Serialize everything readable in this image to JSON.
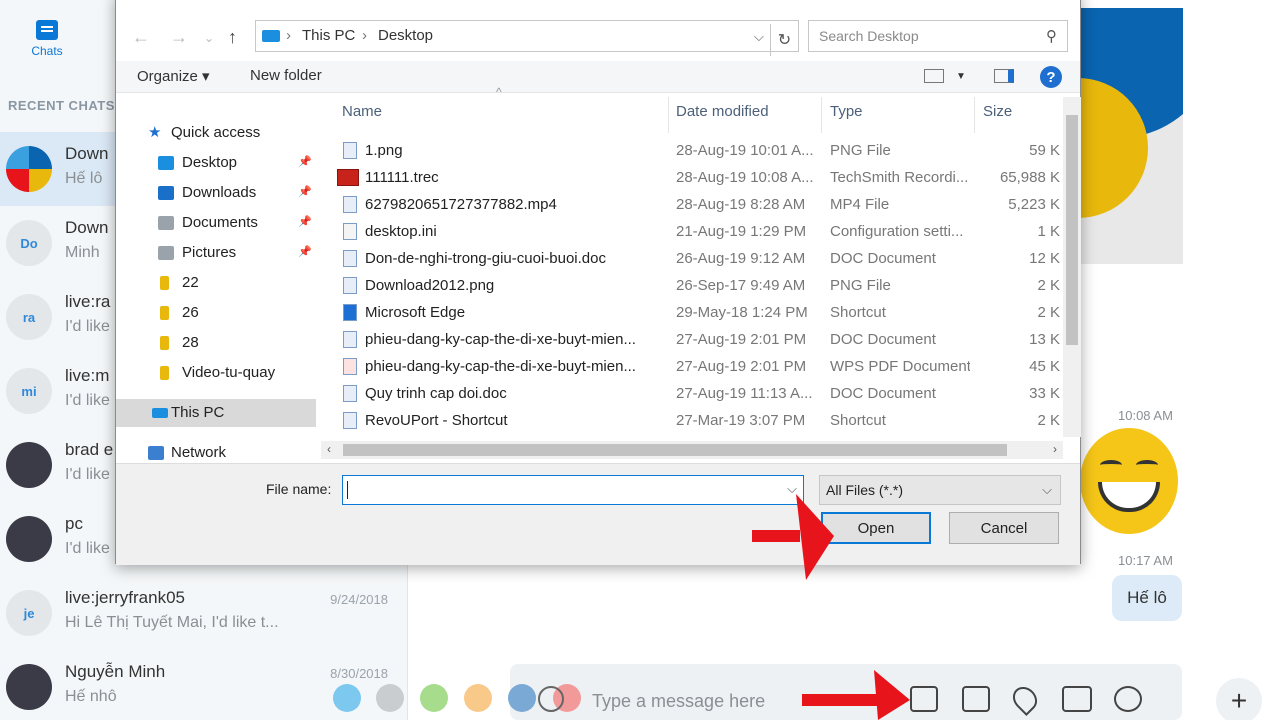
{
  "skype": {
    "nav_chats_label": "Chats",
    "recent_label": "RECENT CHATS",
    "chats": [
      {
        "name": "Down",
        "preview": "Hế lô",
        "date": "",
        "avatar": ""
      },
      {
        "name": "Down",
        "preview": "Minh",
        "date": "",
        "avatar": "Do"
      },
      {
        "name": "live:ra",
        "preview": "I'd like",
        "date": "",
        "avatar": "ra"
      },
      {
        "name": "live:m",
        "preview": "I'd like",
        "date": "",
        "avatar": "mi"
      },
      {
        "name": "brad e",
        "preview": "I'd like",
        "date": "",
        "avatar": ""
      },
      {
        "name": "pc",
        "preview": "I'd like",
        "date": "",
        "avatar": ""
      },
      {
        "name": "live:jerryfrank05",
        "preview": "Hi Lê Thị Tuyết Mai, I'd like t...",
        "date": "9/24/2018",
        "avatar": "je"
      },
      {
        "name": "Nguyễn Minh",
        "preview": "Hế nhô",
        "date": "8/30/2018",
        "avatar": ""
      }
    ],
    "time1": "10:08 AM",
    "time2": "10:17 AM",
    "bubble_text": "Hế lô",
    "compose_placeholder": "Type a message here",
    "plus_label": "+",
    "colors": {
      "accent": "#0a78d7",
      "logo_blue": "#0a64b0",
      "logo_yellow": "#e8b80c"
    }
  },
  "dialog": {
    "breadcrumb": [
      "This PC",
      "Desktop"
    ],
    "search_placeholder": "Search Desktop",
    "toolbar": {
      "organize": "Organize ▾",
      "new_folder": "New folder",
      "help": "?"
    },
    "nav": {
      "quick_access": "Quick access",
      "items": [
        "Desktop",
        "Downloads",
        "Documents",
        "Pictures",
        "22",
        "26",
        "28",
        "Video-tu-quay"
      ],
      "this_pc": "This PC",
      "network": "Network"
    },
    "columns": {
      "name": "Name",
      "date": "Date modified",
      "type": "Type",
      "size": "Size"
    },
    "files": [
      {
        "name": "1.png",
        "date": "28-Aug-19 10:01 A...",
        "type": "PNG File",
        "size": "59 K"
      },
      {
        "name": "111111.trec",
        "date": "28-Aug-19 10:08 A...",
        "type": "TechSmith Recordi...",
        "size": "65,988 K"
      },
      {
        "name": "6279820651727377882.mp4",
        "date": "28-Aug-19 8:28 AM",
        "type": "MP4 File",
        "size": "5,223 K"
      },
      {
        "name": "desktop.ini",
        "date": "21-Aug-19 1:29 PM",
        "type": "Configuration setti...",
        "size": "1 K"
      },
      {
        "name": "Don-de-nghi-trong-giu-cuoi-buoi.doc",
        "date": "26-Aug-19 9:12 AM",
        "type": "DOC Document",
        "size": "12 K"
      },
      {
        "name": "Download2012.png",
        "date": "26-Sep-17 9:49 AM",
        "type": "PNG File",
        "size": "2 K"
      },
      {
        "name": "Microsoft Edge",
        "date": "29-May-18 1:24 PM",
        "type": "Shortcut",
        "size": "2 K"
      },
      {
        "name": "phieu-dang-ky-cap-the-di-xe-buyt-mien...",
        "date": "27-Aug-19 2:01 PM",
        "type": "DOC Document",
        "size": "13 K"
      },
      {
        "name": "phieu-dang-ky-cap-the-di-xe-buyt-mien...",
        "date": "27-Aug-19 2:01 PM",
        "type": "WPS PDF Document",
        "size": "45 K"
      },
      {
        "name": "Quy trinh cap doi.doc",
        "date": "27-Aug-19 11:13 A...",
        "type": "DOC Document",
        "size": "33 K"
      },
      {
        "name": "RevoUPort - Shortcut",
        "date": "27-Mar-19 3:07 PM",
        "type": "Shortcut",
        "size": "2 K"
      }
    ],
    "file_name_label": "File name:",
    "file_name_value": "",
    "filter": "All Files (*.*)",
    "open_label": "Open",
    "cancel_label": "Cancel"
  }
}
